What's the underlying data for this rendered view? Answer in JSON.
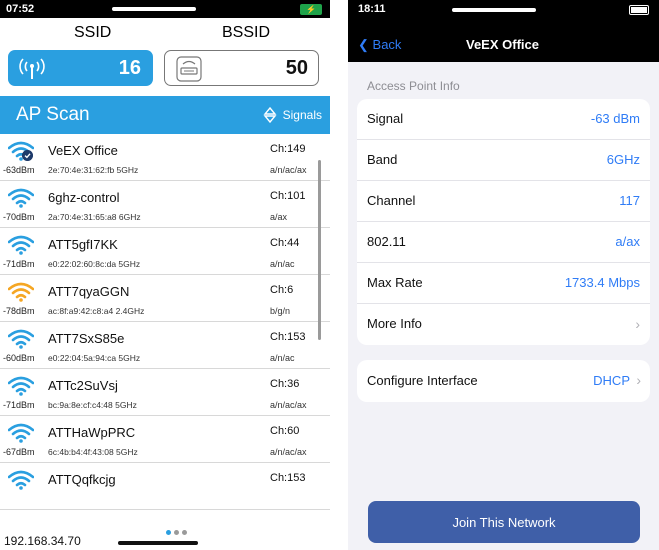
{
  "left": {
    "status": {
      "time": "07:52"
    },
    "headers": {
      "ssid": "SSID",
      "bssid": "BSSID"
    },
    "counts": {
      "ssid": "16",
      "bssid": "50"
    },
    "scan_title": "AP Scan",
    "sort_label": "Signals",
    "networks": [
      {
        "dbm": "-63dBm",
        "ssid": "VeEX Office",
        "mac": "2e:70:4e:31:62:fb 5GHz",
        "ch": "Ch:149",
        "std": "a/n/ac/ax",
        "color": "#2a9fe0",
        "connected": true
      },
      {
        "dbm": "-70dBm",
        "ssid": "6ghz-control",
        "mac": "2a:70:4e:31:65:a8 6GHz",
        "ch": "Ch:101",
        "std": "a/ax",
        "color": "#2a9fe0",
        "connected": false
      },
      {
        "dbm": "-71dBm",
        "ssid": "ATT5gfI7KK",
        "mac": "e0:22:02:60:8c:da 5GHz",
        "ch": "Ch:44",
        "std": "a/n/ac",
        "color": "#2a9fe0",
        "connected": false
      },
      {
        "dbm": "-78dBm",
        "ssid": "ATT7qyaGGN",
        "mac": "ac:8f:a9:42:c8:a4 2.4GHz",
        "ch": "Ch:6",
        "std": "b/g/n",
        "color": "#f5a623",
        "connected": false
      },
      {
        "dbm": "-60dBm",
        "ssid": "ATT7SxS85e",
        "mac": "e0:22:04:5a:94:ca 5GHz",
        "ch": "Ch:153",
        "std": "a/n/ac",
        "color": "#2a9fe0",
        "connected": false
      },
      {
        "dbm": "-71dBm",
        "ssid": "ATTc2SuVsj",
        "mac": "bc:9a:8e:cf:c4:48 5GHz",
        "ch": "Ch:36",
        "std": "a/n/ac/ax",
        "color": "#2a9fe0",
        "connected": false
      },
      {
        "dbm": "-67dBm",
        "ssid": "ATTHaWpPRC",
        "mac": "6c:4b:b4:4f:43:08 5GHz",
        "ch": "Ch:60",
        "std": "a/n/ac/ax",
        "color": "#2a9fe0",
        "connected": false
      },
      {
        "dbm": "",
        "ssid": "ATTQqfkcjg",
        "mac": "",
        "ch": "Ch:153",
        "std": "",
        "color": "#2a9fe0",
        "connected": false
      }
    ],
    "ip": "192.168.34.70"
  },
  "right": {
    "status": {
      "time": "18:11"
    },
    "nav": {
      "back": "Back",
      "title": "VeEX Office"
    },
    "section": "Access Point Info",
    "info": [
      {
        "key": "Signal",
        "value": "-63 dBm"
      },
      {
        "key": "Band",
        "value": "6GHz"
      },
      {
        "key": "Channel",
        "value": "117"
      },
      {
        "key": "802.11",
        "value": "a/ax"
      },
      {
        "key": "Max Rate",
        "value": "1733.4 Mbps"
      },
      {
        "key": "More Info",
        "value": ""
      }
    ],
    "configure": {
      "key": "Configure Interface",
      "value": "DHCP"
    },
    "join": "Join This Network"
  },
  "colors": {
    "accent": "#2a9fe0",
    "link": "#2f7cf6",
    "button": "#3f5fa8",
    "weak_signal": "#f5a623"
  },
  "icons": [
    "wifi-icon",
    "router-icon",
    "sort-icon",
    "chevron-right-icon",
    "chevron-left-icon",
    "battery-icon",
    "connected-check-icon"
  ]
}
